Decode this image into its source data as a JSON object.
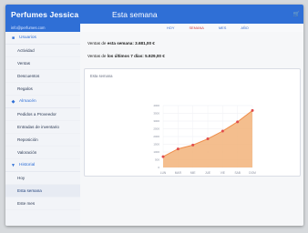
{
  "app": {
    "name": "Perfumes Jessica",
    "email": "info@perfumes.com",
    "section_title": "Esta semana"
  },
  "tabs": [
    {
      "label": "HOY",
      "active": false
    },
    {
      "label": "SEMANA",
      "active": true
    },
    {
      "label": "MES",
      "active": false
    },
    {
      "label": "AÑO",
      "active": false
    }
  ],
  "sidebar": {
    "groups": [
      {
        "label": "Usuarios",
        "items": [
          "Actividad",
          "Ventas",
          "Descuentos",
          "Regalos"
        ]
      },
      {
        "label": "Almacén",
        "items": [
          "Pedidos a Proveedor",
          "Entradas de inventario",
          "Reposición",
          "Valoración"
        ]
      },
      {
        "label": "Historial",
        "items": [
          "Hoy",
          "Esta semana",
          "Este mes"
        ]
      }
    ],
    "active_item": "Esta semana"
  },
  "stats": {
    "week_label": "Ventas de ",
    "week_label_bold": "esta semana",
    "week_value": "3.681,00 €",
    "last7_label": "Ventas de ",
    "last7_label_bold": "los últimos 7 días",
    "last7_value": "5.929,00 €"
  },
  "card": {
    "title": "Esta semana"
  },
  "chart_data": {
    "type": "area",
    "x": [
      "LUN",
      "MAR",
      "MIE",
      "JUE",
      "VIE",
      "SAB",
      "DOM"
    ],
    "values": [
      700,
      1200,
      1450,
      1850,
      2350,
      2950,
      3681
    ],
    "ylim": [
      0,
      4000
    ],
    "grid": true,
    "color": "#f2b37a",
    "line_color": "#ef8d4a",
    "point_color": "#e14d4d"
  },
  "icons": {
    "top_right": "cart-icon",
    "group_user": "user-icon",
    "group_store": "store-icon",
    "group_history": "filter-icon"
  }
}
